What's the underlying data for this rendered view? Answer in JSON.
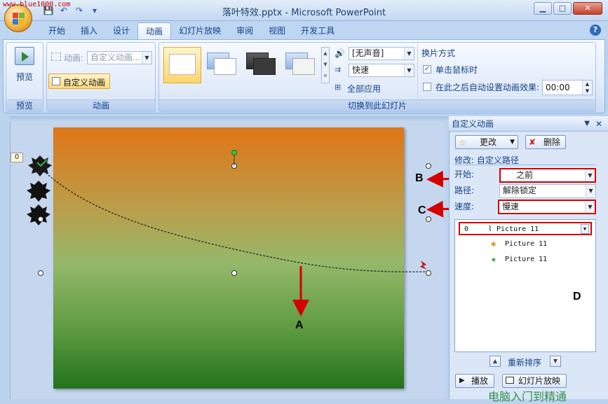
{
  "watermark": "www.blue1000.com",
  "window": {
    "title": "落叶特效.pptx - Microsoft PowerPoint",
    "minimize": "▁",
    "maximize": "□",
    "close": "✕",
    "help": "?"
  },
  "qat": [
    "💾",
    "↶",
    "↷",
    "▾"
  ],
  "tabs": [
    "开始",
    "插入",
    "设计",
    "动画",
    "幻灯片放映",
    "审阅",
    "视图",
    "开发工具"
  ],
  "active_tab": "动画",
  "ribbon": {
    "preview": {
      "button": "预览",
      "group": "预览"
    },
    "animation": {
      "label": "动画:",
      "combo": "自定义动画...",
      "custom_btn": "自定义动画",
      "group": "动画"
    },
    "transition": {
      "sound": "[无声音]",
      "speed": "快速",
      "apply_all": "全部应用",
      "group": "切换到此幻灯片",
      "advance_title": "换片方式",
      "on_click": "单击鼠标时",
      "on_click_checked": true,
      "auto_after": "在此之后自动设置动画效果:",
      "auto_checked": false,
      "time": "00:00"
    }
  },
  "slide": {
    "anim_tag": "0"
  },
  "pane": {
    "title": "自定义动画",
    "change_btn": "更改",
    "delete_btn": "删除",
    "modify_line": "修改: 自定义路径",
    "start_label": "开始:",
    "start_value": "之前",
    "path_label": "路径:",
    "path_value": "解除锁定",
    "speed_label": "速度:",
    "speed_value": "慢速",
    "list": [
      {
        "order": "0",
        "name": "Picture 11",
        "icon": "motion-path-icon"
      },
      {
        "order": "",
        "name": "Picture 11",
        "icon": "spin-effect-icon"
      },
      {
        "order": "",
        "name": "Picture 11",
        "icon": "star-effect-icon"
      }
    ],
    "reorder": "重新排序",
    "play_btn": "播放",
    "slideshow_btn": "幻灯片放映"
  },
  "callouts": {
    "a": "A",
    "b": "B",
    "c": "C",
    "d": "D"
  },
  "bottom_watermark": "电脑入门到精通",
  "colors": {
    "accent_red": "#d40000",
    "ribbon_blue": "#15428b"
  }
}
